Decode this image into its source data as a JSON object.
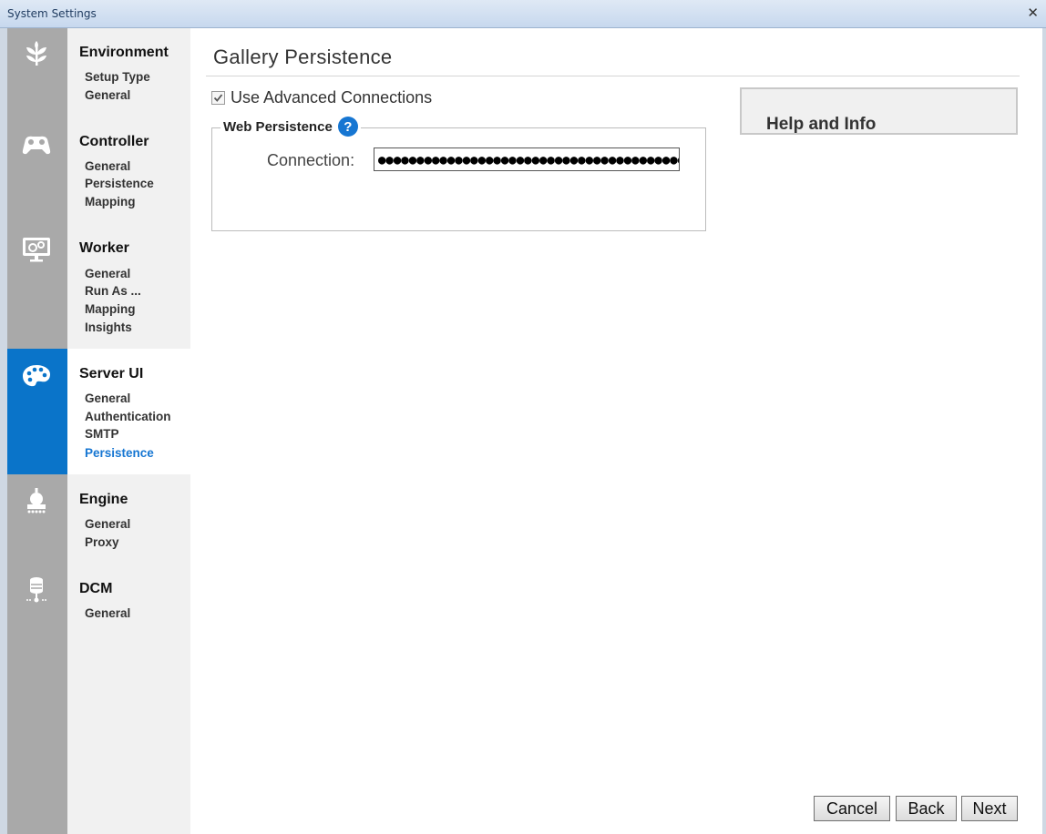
{
  "window": {
    "title": "System Settings",
    "close_glyph": "✕"
  },
  "sidebar": {
    "sections": [
      {
        "title": "Environment",
        "icon": "sprout-icon",
        "items": [
          "Setup Type",
          "General"
        ]
      },
      {
        "title": "Controller",
        "icon": "gamepad-icon",
        "items": [
          "General",
          "Persistence",
          "Mapping"
        ]
      },
      {
        "title": "Worker",
        "icon": "monitor-gears-icon",
        "items": [
          "General",
          "Run As ...",
          "Mapping",
          "Insights"
        ]
      },
      {
        "title": "Server UI",
        "icon": "palette-icon",
        "items": [
          "General",
          "Authentication",
          "SMTP",
          "Persistence"
        ],
        "active": true,
        "current_item": "Persistence"
      },
      {
        "title": "Engine",
        "icon": "engine-icon",
        "items": [
          "General",
          "Proxy"
        ]
      },
      {
        "title": "DCM",
        "icon": "database-network-icon",
        "items": [
          "General"
        ]
      }
    ],
    "active_color": "#0a74c9"
  },
  "main": {
    "title": "Gallery Persistence",
    "use_advanced": {
      "label": "Use Advanced Connections",
      "checked": true
    },
    "web_persistence": {
      "legend": "Web Persistence",
      "help_icon": "question-icon",
      "connection_label": "Connection:",
      "connection_value": "●●●●●●●●●●●●●●●●●●●●●●●●●●●●●●●●●●●●●●●●●●"
    }
  },
  "help": {
    "title": "Help and Info"
  },
  "footer": {
    "cancel": "Cancel",
    "back": "Back",
    "next": "Next"
  }
}
